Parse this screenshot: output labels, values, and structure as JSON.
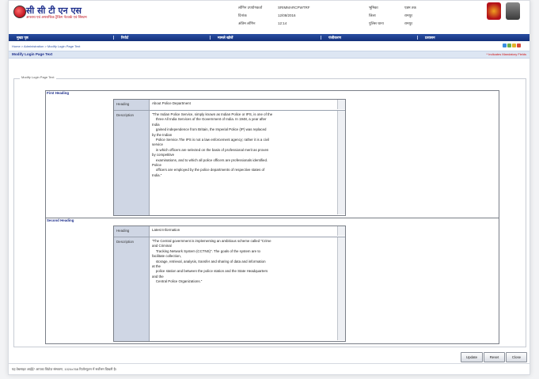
{
  "header": {
    "logo_text": "सी सी टी एन एस",
    "logo_subtitle": "अपराध एवं अपराधिक ट्रैकिंग नेटवर्क एवं सिस्टम",
    "info": [
      {
        "label": "लॉगिन उपयोगकर्ता",
        "value": "SRIMMARCPWTRF"
      },
      {
        "label": "दिनांक",
        "value": "12/08/2016"
      },
      {
        "label": "अंतिम लॉगिन",
        "value": "12:14"
      },
      {
        "label": "भूमिका",
        "value": "एडम तक"
      },
      {
        "label": "जिला",
        "value": "रामपुर"
      },
      {
        "label": "पुलिस थाना",
        "value": "रामपुर"
      }
    ]
  },
  "menu": {
    "items": [
      "मुख्य पृष्ठ",
      "रिपोर्ट",
      "मामले खोजें",
      "पंजीकरण",
      "प्रशासन"
    ]
  },
  "breadcrumb": "Home > Administration > Modify Login Page Text",
  "page": {
    "title": "Modify Login Page Text",
    "mandatory_note": "* Indicates Mandatory Fields",
    "legend": "Modify Login Page Text"
  },
  "first_section": {
    "label": "First Heading",
    "heading_label": "Heading",
    "heading_value": "About Police Department",
    "description_label": "Description",
    "description_value": "\"The Indian Police Service, simply known as Indian Police or IPS, is one of the\n    three All India Services of the Government of India. In 1948, a year after\nIndia\n    gained independence from Britain, the Imperial Police (IP) was replaced\nby the Indian\n    Police Service.The IPS is not a law enforcement agency; rather it is a civil\nservice\n    in which officers are selected on the basis of professional merit as proven\nby competitive\n    examinations, and to which all police officers are professionals identified.\nPolice\n    officers are employed by the police departments of respective states of\nIndia.\""
  },
  "second_section": {
    "label": "Second Heading",
    "heading_label": "Heading",
    "heading_value": "Latest Information",
    "description_label": "Description",
    "description_value": "\"The Central government is implementing an ambitious scheme called \"Crime\nand Criminal\n    Tracking Network System (CCTNS)\". The goals of the system are to\nfacilitate collection,\n    storage, retrieval, analysis, transfer and sharing of data and information\nat the\n    police station and between the police station and the State Headquarters\nand the\n    Central Police Organizations.\""
  },
  "buttons": {
    "update": "Update",
    "reset": "Reset",
    "close": "Close"
  },
  "footer": "यह वेबसाइट आईई7 आपका विंडोज़ संस्करण, 1024x768 रिज़ॉल्यूशन में सर्वोत्तम दिखती है।",
  "colors": {
    "menu_bar": "#1e3f8f",
    "title_bar": "#dde6f3",
    "label_cell": "#cfd6e4",
    "mandatory": "#d01010"
  }
}
